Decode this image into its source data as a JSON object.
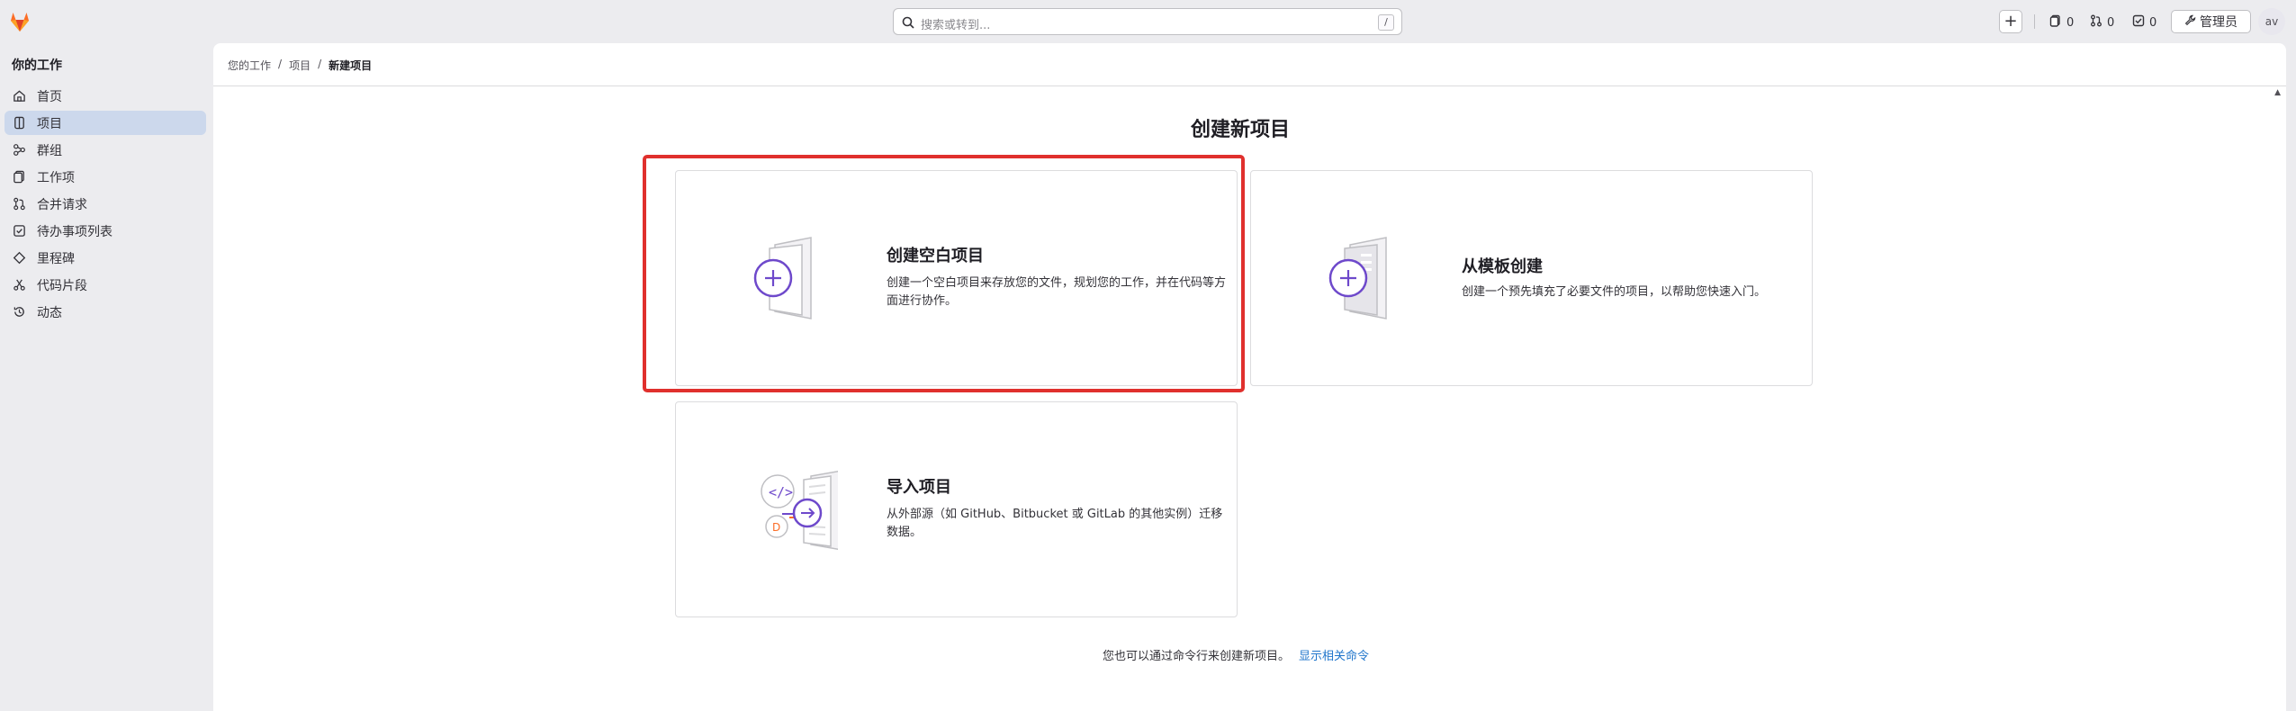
{
  "search": {
    "placeholder": "搜索或转到...",
    "shortcut": "/"
  },
  "topbar": {
    "create_label": "+",
    "issues_count": "0",
    "merge_requests_count": "0",
    "todos_count": "0",
    "admin_label": "管理员",
    "avatar_alt": "av"
  },
  "sidebar": {
    "title": "你的工作",
    "items": [
      {
        "label": "首页",
        "icon": "home-icon"
      },
      {
        "label": "项目",
        "icon": "project-icon",
        "active": true
      },
      {
        "label": "群组",
        "icon": "group-icon"
      },
      {
        "label": "工作项",
        "icon": "work-items-icon"
      },
      {
        "label": "合并请求",
        "icon": "merge-request-icon"
      },
      {
        "label": "待办事项列表",
        "icon": "todo-icon"
      },
      {
        "label": "里程碑",
        "icon": "milestone-icon"
      },
      {
        "label": "代码片段",
        "icon": "snippet-icon"
      },
      {
        "label": "动态",
        "icon": "history-icon"
      }
    ]
  },
  "breadcrumb": [
    "您的工作",
    "项目",
    "新建项目"
  ],
  "page": {
    "title": "创建新项目",
    "cards": [
      {
        "title": "创建空白项目",
        "desc": "创建一个空白项目来存放您的文件，规划您的工作，并在代码等方面进行协作。"
      },
      {
        "title": "从模板创建",
        "desc": "创建一个预先填充了必要文件的项目，以帮助您快速入门。"
      },
      {
        "title": "导入项目",
        "desc": "从外部源（如 GitHub、Bitbucket 或 GitLab 的其他实例）迁移数据。"
      }
    ],
    "cli_text": "您也可以通过命令行来创建新项目。",
    "cli_link": "显示相关命令"
  },
  "colors": {
    "accent": "#6e49cb",
    "highlight": "#e0302d",
    "link": "#1f75cb",
    "active_nav": "#ccd8ec"
  }
}
